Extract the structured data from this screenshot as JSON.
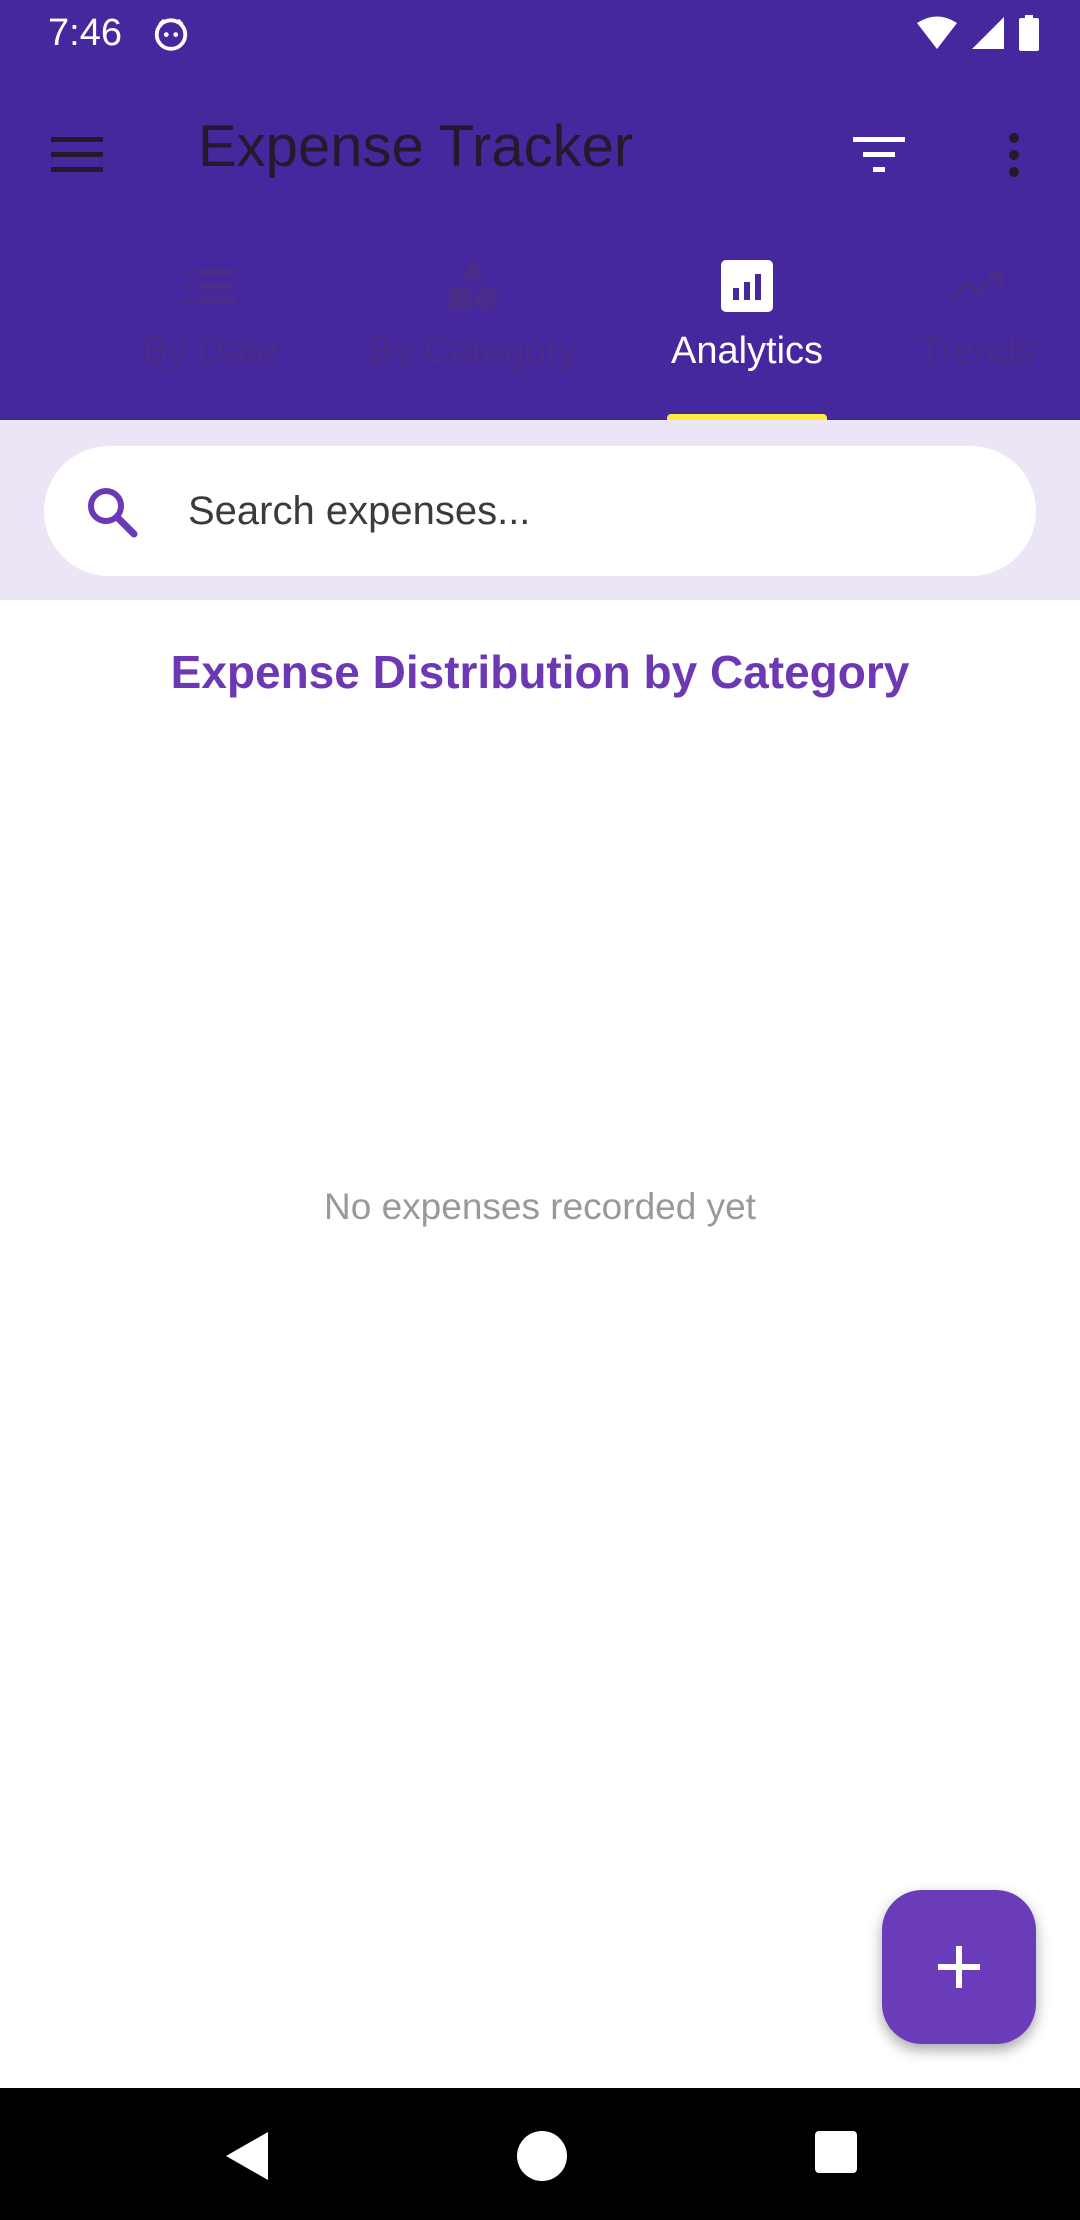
{
  "status_bar": {
    "time": "7:46"
  },
  "app_bar": {
    "title": "Expense Tracker",
    "menu_icon": "hamburger-menu-icon",
    "filter_icon": "filter-icon",
    "more_icon": "more-vert-icon"
  },
  "tabs": [
    {
      "label": "By Date",
      "icon": "list-icon",
      "active": false
    },
    {
      "label": "By Category",
      "icon": "category-shapes-icon",
      "active": false
    },
    {
      "label": "Analytics",
      "icon": "analytics-icon",
      "active": true
    },
    {
      "label": "Trends",
      "icon": "trending-up-icon",
      "active": false
    }
  ],
  "search": {
    "placeholder": "Search expenses..."
  },
  "content": {
    "section_title": "Expense Distribution by Category",
    "empty_message": "No expenses recorded yet"
  },
  "fab": {
    "icon": "plus-icon"
  },
  "colors": {
    "primary": "#45289e",
    "accent_indicator": "#ffeb3b",
    "title_purple": "#6d38b4",
    "fab": "#6a3cba",
    "search_bg": "#ece5f5"
  }
}
